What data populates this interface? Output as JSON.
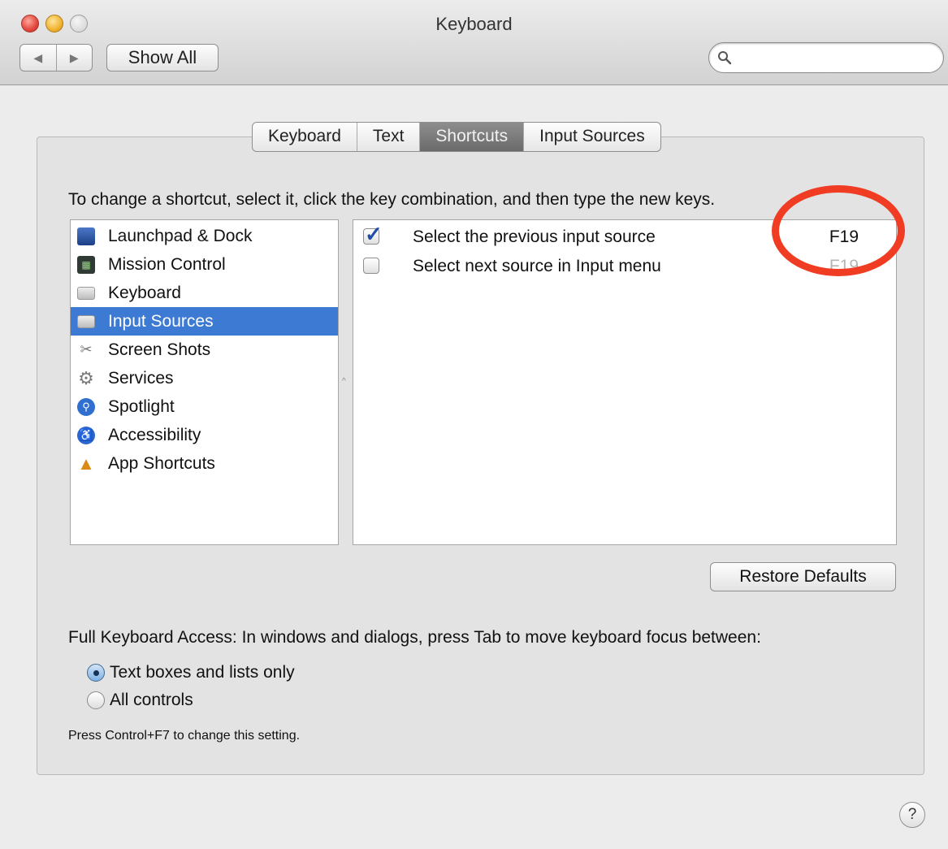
{
  "window": {
    "title": "Keyboard",
    "back_glyph": "◀",
    "forward_glyph": "▶",
    "show_all_label": "Show All",
    "search_placeholder": ""
  },
  "tabs": [
    {
      "label": "Keyboard",
      "selected": false
    },
    {
      "label": "Text",
      "selected": false
    },
    {
      "label": "Shortcuts",
      "selected": true
    },
    {
      "label": "Input Sources",
      "selected": false
    }
  ],
  "instructions": "To change a shortcut, select it, click the key combination, and then type the new keys.",
  "categories": [
    {
      "label": "Launchpad & Dock",
      "icon": "launchpad-icon",
      "glyph": "▬"
    },
    {
      "label": "Mission Control",
      "icon": "mission-control-icon",
      "glyph": "▦"
    },
    {
      "label": "Keyboard",
      "icon": "keyboard-icon",
      "glyph": ""
    },
    {
      "label": "Input Sources",
      "icon": "keyboard-icon",
      "glyph": "",
      "selected": true
    },
    {
      "label": "Screen Shots",
      "icon": "screenshot-icon",
      "glyph": "✂"
    },
    {
      "label": "Services",
      "icon": "gear-icon",
      "glyph": "⚙"
    },
    {
      "label": "Spotlight",
      "icon": "spotlight-icon",
      "glyph": "⚲"
    },
    {
      "label": "Accessibility",
      "icon": "accessibility-icon",
      "glyph": "♿"
    },
    {
      "label": "App Shortcuts",
      "icon": "app-store-icon",
      "glyph": "▲"
    }
  ],
  "shortcuts": [
    {
      "label": "Select the previous input source",
      "key": "F19",
      "checked": true
    },
    {
      "label": "Select next source in Input menu",
      "key": "F19",
      "checked": false
    }
  ],
  "annotation": {
    "color": "#f03c22"
  },
  "accent_color": "#3c7ad4",
  "restore_defaults_label": "Restore Defaults",
  "full_keyboard_access": {
    "description": "Full Keyboard Access: In windows and dialogs, press Tab to move keyboard focus between:",
    "options": [
      {
        "label": "Text boxes and lists only",
        "selected": true
      },
      {
        "label": "All controls",
        "selected": false
      }
    ],
    "hint": "Press Control+F7 to change this setting."
  },
  "help_label": "?"
}
